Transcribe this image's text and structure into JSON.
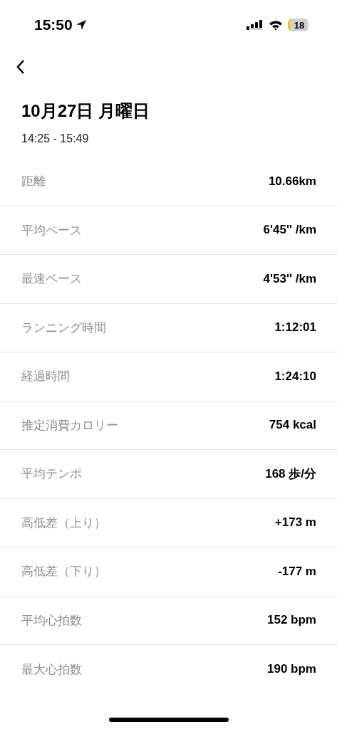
{
  "status_bar": {
    "time": "15:50",
    "battery": "18"
  },
  "header": {
    "title": "10月27日 月曜日",
    "time_range": "14:25 - 15:49"
  },
  "stats": [
    {
      "label": "距離",
      "value": "10.66km"
    },
    {
      "label": "平均ペース",
      "value": "6'45'' /km"
    },
    {
      "label": "最速ペース",
      "value": "4'53'' /km"
    },
    {
      "label": "ランニング時間",
      "value": "1:12:01"
    },
    {
      "label": "経過時間",
      "value": "1:24:10"
    },
    {
      "label": "推定消費カロリー",
      "value": "754 kcal"
    },
    {
      "label": "平均テンポ",
      "value": "168 歩/分"
    },
    {
      "label": "高低差（上り）",
      "value": "+173 m"
    },
    {
      "label": "高低差（下り）",
      "value": "-177 m"
    },
    {
      "label": "平均心拍数",
      "value": "152 bpm"
    },
    {
      "label": "最大心拍数",
      "value": "190 bpm"
    }
  ]
}
